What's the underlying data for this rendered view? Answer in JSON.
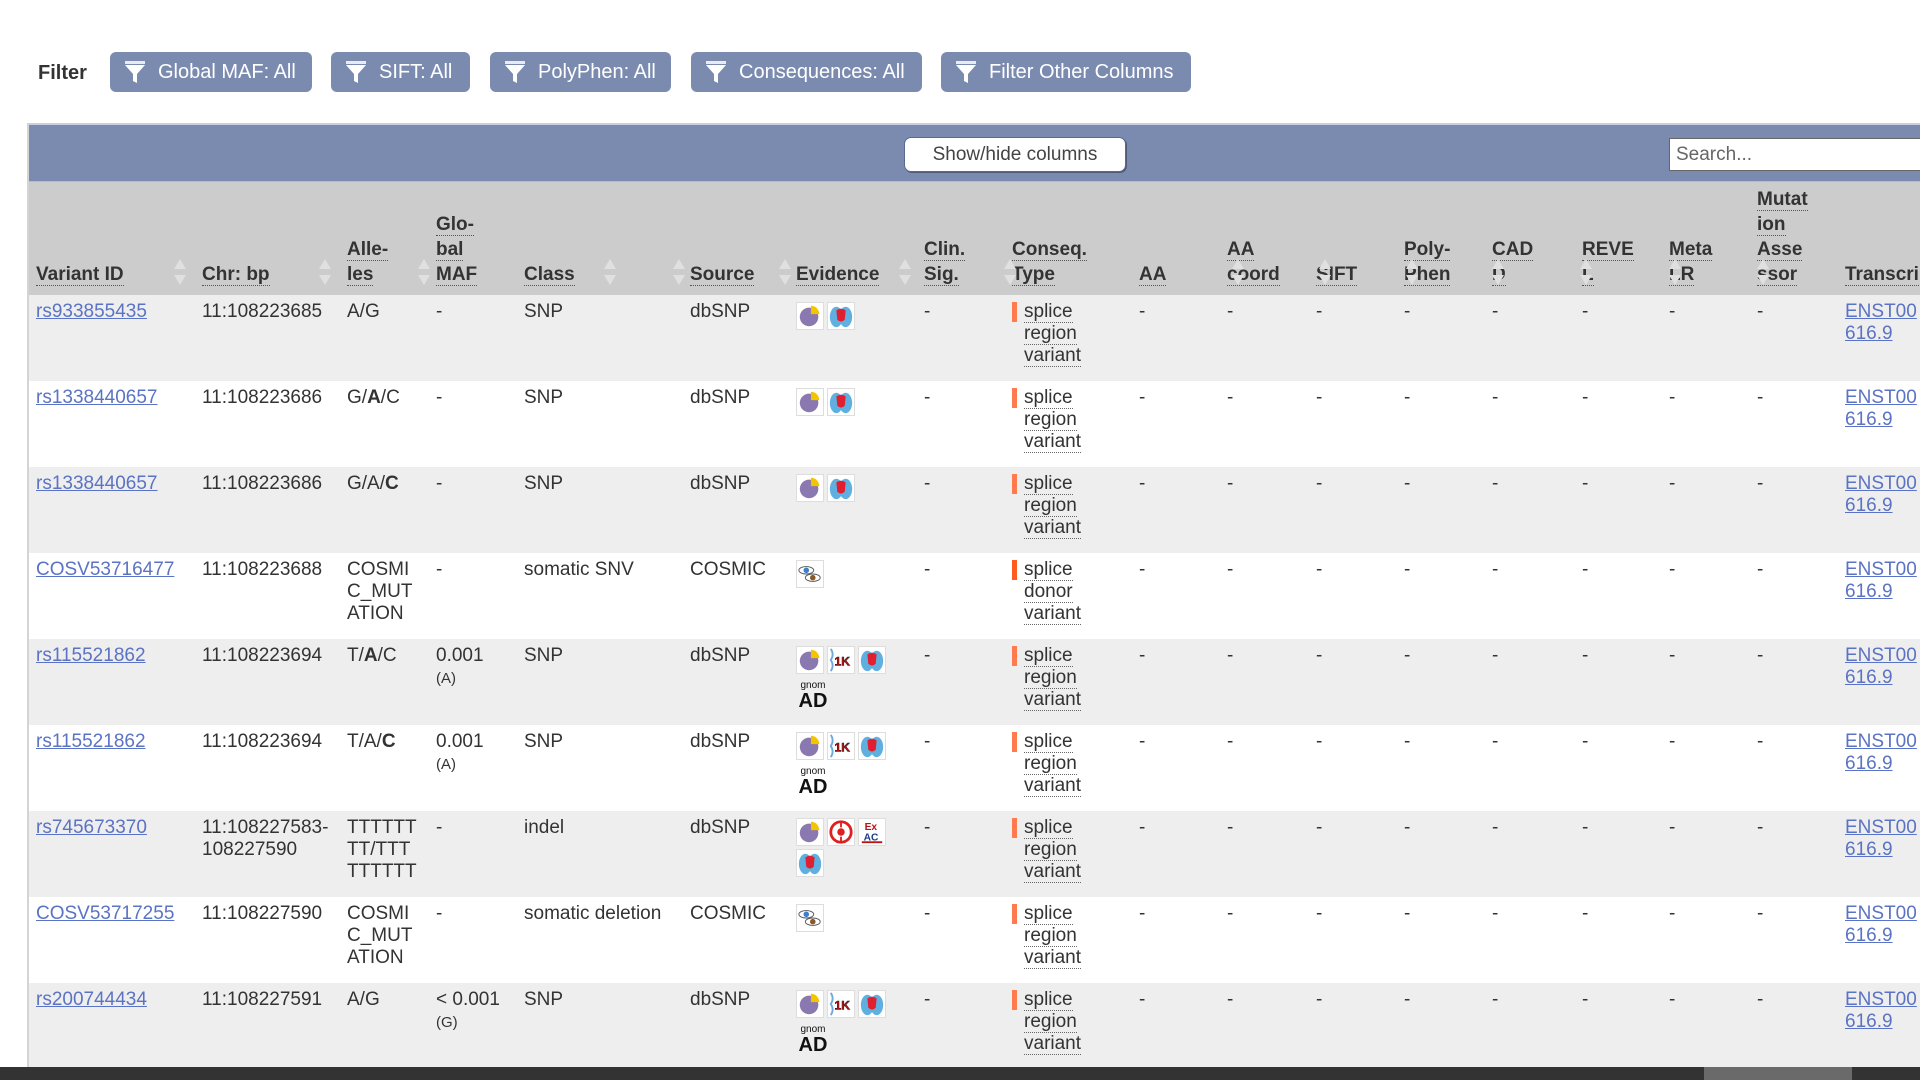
{
  "filters": {
    "label": "Filter",
    "buttons": [
      {
        "label": "Global MAF: All",
        "icon": "funnel-icon"
      },
      {
        "label": "SIFT: All",
        "icon": "funnel-icon"
      },
      {
        "label": "PolyPhen: All",
        "icon": "funnel-icon"
      },
      {
        "label": "Consequences: All",
        "icon": "funnel-icon"
      },
      {
        "label": "Filter Other Columns",
        "icon": "funnel-icon"
      }
    ]
  },
  "toolbar": {
    "showhide_label": "Show/hide columns",
    "search_placeholder": "Search..."
  },
  "colors": {
    "accent": "#7b8bb0",
    "header_bg": "#cccccc",
    "link": "#5b73c4",
    "splice_region": "#ff7a4d",
    "splice_donor": "#ff5a1f"
  },
  "columns": [
    {
      "key": "variant_id",
      "lines": [
        "Variant ID"
      ],
      "sortable": true
    },
    {
      "key": "chr_bp",
      "lines": [
        "Chr: bp"
      ],
      "sortable": true
    },
    {
      "key": "alleles",
      "lines": [
        "Alle-",
        "les"
      ],
      "sortable": false
    },
    {
      "key": "global_maf",
      "lines": [
        "Glo-",
        "bal",
        "MAF"
      ],
      "sortable": true
    },
    {
      "key": "class",
      "lines": [
        "Class"
      ],
      "sortable": true
    },
    {
      "key": "source",
      "lines": [
        "Source"
      ],
      "sortable": true
    },
    {
      "key": "evidence",
      "lines": [
        "Evidence"
      ],
      "sortable": true
    },
    {
      "key": "clin_sig",
      "lines": [
        "Clin.",
        "Sig."
      ],
      "sortable": true
    },
    {
      "key": "conseq_type",
      "lines": [
        "Conseq.",
        "Type"
      ],
      "sortable": true
    },
    {
      "key": "aa",
      "lines": [
        "AA"
      ],
      "sortable": false
    },
    {
      "key": "aa_coord",
      "lines": [
        "AA",
        "coord"
      ],
      "sortable": true
    },
    {
      "key": "sift",
      "lines": [
        "SIFT"
      ],
      "sortable": true
    },
    {
      "key": "polyphen",
      "lines": [
        "Poly-",
        "Phen"
      ],
      "sortable": true
    },
    {
      "key": "cadd",
      "lines": [
        "CAD",
        "D"
      ],
      "sortable": true
    },
    {
      "key": "revel",
      "lines": [
        "REVE",
        "L"
      ],
      "sortable": true
    },
    {
      "key": "metalr",
      "lines": [
        "Meta",
        "LR"
      ],
      "sortable": true
    },
    {
      "key": "mutation_assessor",
      "lines": [
        "Mutat",
        "ion",
        "Asse",
        "ssor"
      ],
      "sortable": true
    },
    {
      "key": "transcript",
      "lines": [
        "Transcri"
      ],
      "sortable": false
    }
  ],
  "rows": [
    {
      "variant_id": "rs933855435",
      "chr_bp": [
        "11:108223685"
      ],
      "alleles": [
        [
          "A/G",
          false
        ]
      ],
      "maf": "-",
      "maf_allele": "",
      "class": "SNP",
      "source": "dbSNP",
      "evidence": [
        "frequency",
        "hapmap"
      ],
      "gnomad": false,
      "clin_sig": "-",
      "conseq": [
        "splice",
        "region",
        "variant"
      ],
      "conseq_color": "splice_region",
      "aa": "-",
      "aa_coord": "-",
      "sift": "-",
      "polyphen": "-",
      "cadd": "-",
      "revel": "-",
      "metalr": "-",
      "mutation_assessor": "-",
      "transcript": [
        "ENST00",
        "616.9"
      ]
    },
    {
      "variant_id": "rs1338440657",
      "chr_bp": [
        "11:108223686"
      ],
      "alleles": [
        [
          "G/",
          false
        ],
        [
          "A",
          true
        ],
        [
          "/C",
          false
        ]
      ],
      "maf": "-",
      "maf_allele": "",
      "class": "SNP",
      "source": "dbSNP",
      "evidence": [
        "frequency",
        "hapmap"
      ],
      "gnomad": false,
      "clin_sig": "-",
      "conseq": [
        "splice",
        "region",
        "variant"
      ],
      "conseq_color": "splice_region",
      "aa": "-",
      "aa_coord": "-",
      "sift": "-",
      "polyphen": "-",
      "cadd": "-",
      "revel": "-",
      "metalr": "-",
      "mutation_assessor": "-",
      "transcript": [
        "ENST00",
        "616.9"
      ]
    },
    {
      "variant_id": "rs1338440657",
      "chr_bp": [
        "11:108223686"
      ],
      "alleles": [
        [
          "G/A/",
          false
        ],
        [
          "C",
          true
        ]
      ],
      "maf": "-",
      "maf_allele": "",
      "class": "SNP",
      "source": "dbSNP",
      "evidence": [
        "frequency",
        "hapmap"
      ],
      "gnomad": false,
      "clin_sig": "-",
      "conseq": [
        "splice",
        "region",
        "variant"
      ],
      "conseq_color": "splice_region",
      "aa": "-",
      "aa_coord": "-",
      "sift": "-",
      "polyphen": "-",
      "cadd": "-",
      "revel": "-",
      "metalr": "-",
      "mutation_assessor": "-",
      "transcript": [
        "ENST00",
        "616.9"
      ]
    },
    {
      "variant_id": "COSV53716477",
      "chr_bp": [
        "11:108223688"
      ],
      "alleles": [
        [
          "COSMI C_MUT ATION",
          false
        ]
      ],
      "maf": "-",
      "maf_allele": "",
      "class": "somatic SNV",
      "source": "COSMIC",
      "evidence": [
        "cited"
      ],
      "gnomad": false,
      "clin_sig": "-",
      "conseq": [
        "splice",
        "donor",
        "variant"
      ],
      "conseq_color": "splice_donor",
      "aa": "-",
      "aa_coord": "-",
      "sift": "-",
      "polyphen": "-",
      "cadd": "-",
      "revel": "-",
      "metalr": "-",
      "mutation_assessor": "-",
      "transcript": [
        "ENST00",
        "616.9"
      ]
    },
    {
      "variant_id": "rs115521862",
      "chr_bp": [
        "11:108223694"
      ],
      "alleles": [
        [
          "T/",
          false
        ],
        [
          "A",
          true
        ],
        [
          "/C",
          false
        ]
      ],
      "maf": "0.001",
      "maf_allele": "(A)",
      "class": "SNP",
      "source": "dbSNP",
      "evidence": [
        "frequency",
        "1000genomes",
        "hapmap"
      ],
      "gnomad": true,
      "clin_sig": "-",
      "conseq": [
        "splice",
        "region",
        "variant"
      ],
      "conseq_color": "splice_region",
      "aa": "-",
      "aa_coord": "-",
      "sift": "-",
      "polyphen": "-",
      "cadd": "-",
      "revel": "-",
      "metalr": "-",
      "mutation_assessor": "-",
      "transcript": [
        "ENST00",
        "616.9"
      ]
    },
    {
      "variant_id": "rs115521862",
      "chr_bp": [
        "11:108223694"
      ],
      "alleles": [
        [
          "T/A/",
          false
        ],
        [
          "C",
          true
        ]
      ],
      "maf": "0.001",
      "maf_allele": "(A)",
      "class": "SNP",
      "source": "dbSNP",
      "evidence": [
        "frequency",
        "1000genomes",
        "hapmap"
      ],
      "gnomad": true,
      "clin_sig": "-",
      "conseq": [
        "splice",
        "region",
        "variant"
      ],
      "conseq_color": "splice_region",
      "aa": "-",
      "aa_coord": "-",
      "sift": "-",
      "polyphen": "-",
      "cadd": "-",
      "revel": "-",
      "metalr": "-",
      "mutation_assessor": "-",
      "transcript": [
        "ENST00",
        "616.9"
      ]
    },
    {
      "variant_id": "rs745673370",
      "chr_bp": [
        "11:108227583-",
        "108227590"
      ],
      "alleles": [
        [
          "TTTTTT TT/TTT TTTTTT",
          false
        ]
      ],
      "maf": "-",
      "maf_allele": "",
      "class": "indel",
      "source": "dbSNP",
      "evidence": [
        "frequency",
        "topmed",
        "exac",
        "hapmap"
      ],
      "gnomad": false,
      "clin_sig": "-",
      "conseq": [
        "splice",
        "region",
        "variant"
      ],
      "conseq_color": "splice_region",
      "aa": "-",
      "aa_coord": "-",
      "sift": "-",
      "polyphen": "-",
      "cadd": "-",
      "revel": "-",
      "metalr": "-",
      "mutation_assessor": "-",
      "transcript": [
        "ENST00",
        "616.9"
      ]
    },
    {
      "variant_id": "COSV53717255",
      "chr_bp": [
        "11:108227590"
      ],
      "alleles": [
        [
          "COSMI C_MUT ATION",
          false
        ]
      ],
      "maf": "-",
      "maf_allele": "",
      "class": "somatic deletion",
      "source": "COSMIC",
      "evidence": [
        "cited"
      ],
      "gnomad": false,
      "clin_sig": "-",
      "conseq": [
        "splice",
        "region",
        "variant"
      ],
      "conseq_color": "splice_region",
      "aa": "-",
      "aa_coord": "-",
      "sift": "-",
      "polyphen": "-",
      "cadd": "-",
      "revel": "-",
      "metalr": "-",
      "mutation_assessor": "-",
      "transcript": [
        "ENST00",
        "616.9"
      ]
    },
    {
      "variant_id": "rs200744434",
      "chr_bp": [
        "11:108227591"
      ],
      "alleles": [
        [
          "A/G",
          false
        ]
      ],
      "maf": "< 0.001",
      "maf_allele": "(G)",
      "class": "SNP",
      "source": "dbSNP",
      "evidence": [
        "frequency",
        "1000genomes",
        "hapmap"
      ],
      "gnomad": true,
      "clin_sig": "-",
      "conseq": [
        "splice",
        "region",
        "variant"
      ],
      "conseq_color": "splice_region",
      "aa": "-",
      "aa_coord": "-",
      "sift": "-",
      "polyphen": "-",
      "cadd": "-",
      "revel": "-",
      "metalr": "-",
      "mutation_assessor": "-",
      "transcript": [
        "ENST00",
        "616.9"
      ]
    }
  ],
  "evidence_labels": {
    "gnomad_top": "gnom",
    "gnomad_bottom": "AD",
    "exac_top": "Ex",
    "exac_bottom": "AC",
    "thousand_genomes": "1K"
  }
}
